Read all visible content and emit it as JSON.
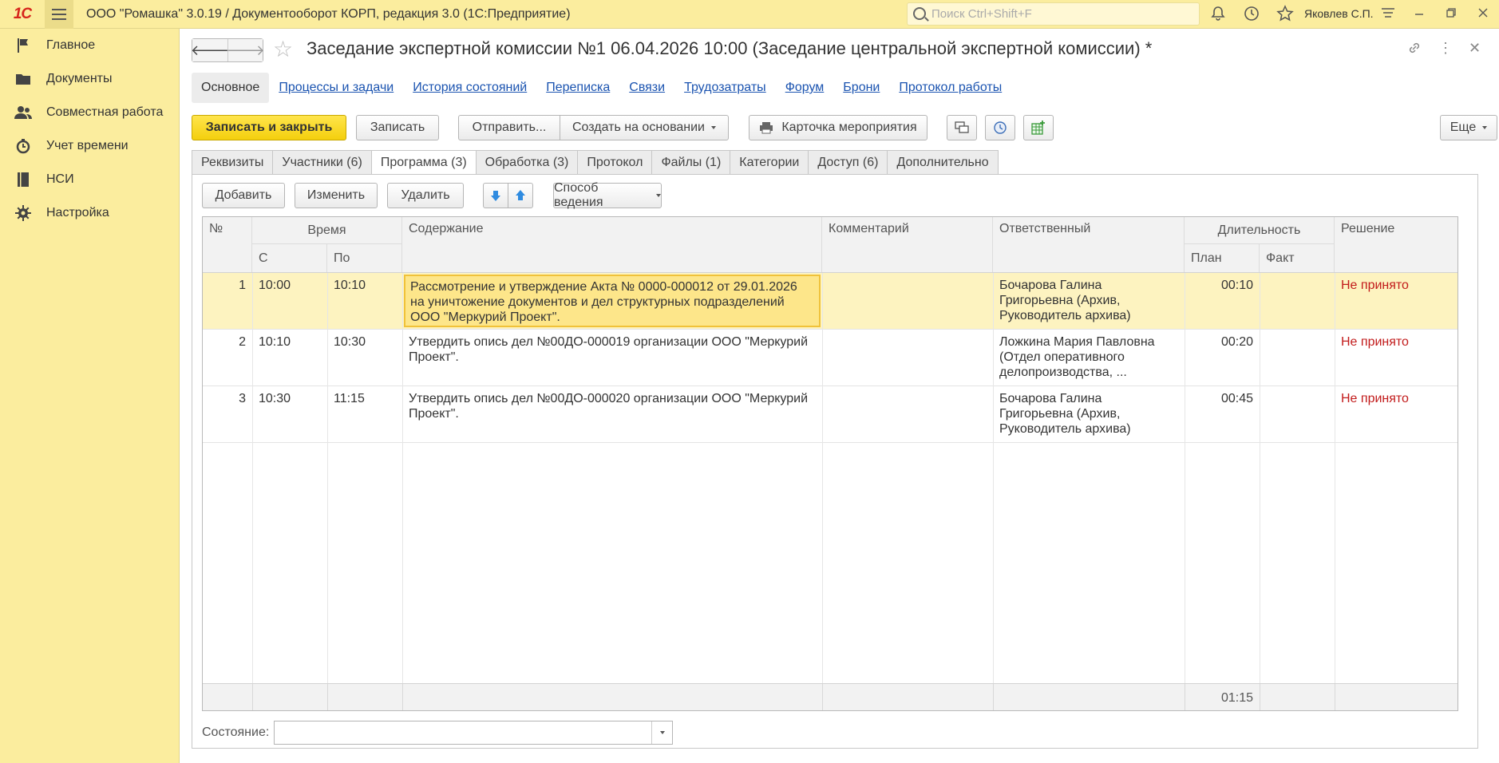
{
  "topbar": {
    "logo": "1С",
    "app_title": "ООО \"Ромашка\" 3.0.19 / Документооборот КОРП, редакция 3.0  (1С:Предприятие)",
    "search_placeholder": "Поиск Ctrl+Shift+F",
    "user": "Яковлев С.П."
  },
  "sidebar": {
    "items": [
      {
        "label": "Главное",
        "icon": "flag-icon"
      },
      {
        "label": "Документы",
        "icon": "folder-icon"
      },
      {
        "label": "Совместная работа",
        "icon": "users-icon"
      },
      {
        "label": "Учет времени",
        "icon": "clock-icon"
      },
      {
        "label": "НСИ",
        "icon": "book-icon"
      },
      {
        "label": "Настройка",
        "icon": "gear-icon"
      }
    ]
  },
  "document": {
    "title": "Заседание экспертной комиссии №1 06.04.2026 10:00 (Заседание центральной экспертной комиссии) *"
  },
  "sections": {
    "active": "Основное",
    "links": [
      "Процессы и задачи",
      "История состояний",
      "Переписка",
      "Связи",
      "Трудозатраты",
      "Форум",
      "Брони",
      "Протокол работы"
    ]
  },
  "commands": {
    "save_close": "Записать и закрыть",
    "save": "Записать",
    "send": "Отправить...",
    "create_based": "Создать на основании",
    "event_card": "Карточка мероприятия",
    "more": "Еще"
  },
  "tabs": [
    "Реквизиты",
    "Участники (6)",
    "Программа (3)",
    "Обработка (3)",
    "Протокол",
    "Файлы (1)",
    "Категории",
    "Доступ (6)",
    "Дополнительно"
  ],
  "active_tab": "Программа (3)",
  "program_bar": {
    "add": "Добавить",
    "edit": "Изменить",
    "delete": "Удалить",
    "mode": "Способ ведения"
  },
  "table": {
    "headers": {
      "num": "№",
      "time": "Время",
      "from": "С",
      "to": "По",
      "content": "Содержание",
      "comment": "Комментарий",
      "responsible": "Ответственный",
      "duration": "Длительность",
      "plan": "План",
      "fact": "Факт",
      "decision": "Решение"
    },
    "rows": [
      {
        "num": "1",
        "from": "10:00",
        "to": "10:10",
        "content": "Рассмотрение и утверждение Акта № 0000-000012 от 29.01.2026 на уничтожение документов и дел структурных подразделений ООО \"Меркурий Проект\".",
        "comment": "",
        "responsible": "Бочарова Галина Григорьевна (Архив, Руководитель архива)",
        "plan": "00:10",
        "fact": "",
        "decision": "Не принято"
      },
      {
        "num": "2",
        "from": "10:10",
        "to": "10:30",
        "content": "Утвердить опись дел №00ДО-000019 организации ООО \"Меркурий Проект\".",
        "comment": "",
        "responsible": "Ложкина Мария Павловна (Отдел оперативного делопроизводства, ...",
        "plan": "00:20",
        "fact": "",
        "decision": "Не принято"
      },
      {
        "num": "3",
        "from": "10:30",
        "to": "11:15",
        "content": "Утвердить опись дел №00ДО-000020 организации ООО \"Меркурий Проект\".",
        "comment": "",
        "responsible": "Бочарова Галина Григорьевна (Архив, Руководитель архива)",
        "plan": "00:45",
        "fact": "",
        "decision": "Не принято"
      }
    ],
    "total_plan": "01:15"
  },
  "state": {
    "label": "Состояние:",
    "value": ""
  },
  "colors": {
    "accent_yellow": "#fbed9e",
    "primary_button": "#f4cf0d",
    "decision_red": "#c21b1b",
    "link_blue": "#1a53b0"
  }
}
